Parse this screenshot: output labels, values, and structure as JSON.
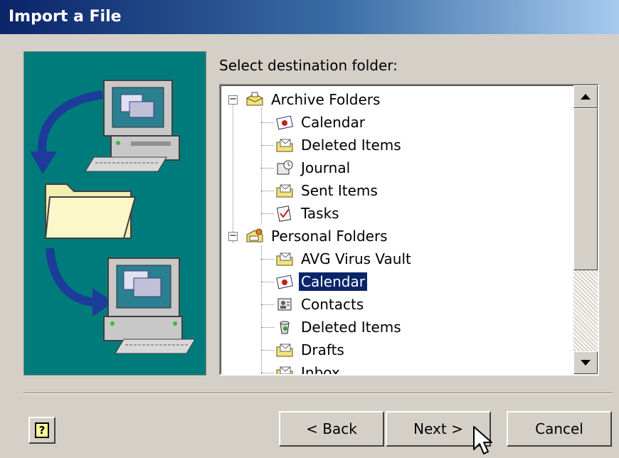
{
  "window": {
    "title": "Import a File"
  },
  "prompt": "Select destination folder:",
  "tree": {
    "groups": [
      {
        "label": "Archive Folders",
        "expander": "−",
        "items": [
          "Calendar",
          "Deleted Items",
          "Journal",
          "Sent Items",
          "Tasks"
        ]
      },
      {
        "label": "Personal Folders",
        "expander": "−",
        "items": [
          "AVG Virus Vault",
          "Calendar",
          "Contacts",
          "Deleted Items",
          "Drafts",
          "Inbox"
        ],
        "selected_item": "Calendar"
      }
    ]
  },
  "buttons": {
    "help": "?",
    "back": "< Back",
    "next": "Next >",
    "cancel": "Cancel"
  },
  "colors": {
    "title_gradient_start": "#0a246a",
    "title_gradient_end": "#a6caf0",
    "illustration_bg": "#007b7b",
    "selection": "#0a246a",
    "dialog_bg": "#d4d0c8"
  },
  "icons": {
    "illustration": [
      "computer-icon",
      "arrow-down-icon",
      "folder-icon",
      "arrow-right-icon",
      "computer-icon"
    ],
    "tree": [
      "archive-folders-icon",
      "calendar-icon",
      "mail-folder-icon",
      "journal-icon",
      "tasks-icon",
      "personal-folders-icon",
      "contacts-icon",
      "deleted-items-icon"
    ]
  }
}
